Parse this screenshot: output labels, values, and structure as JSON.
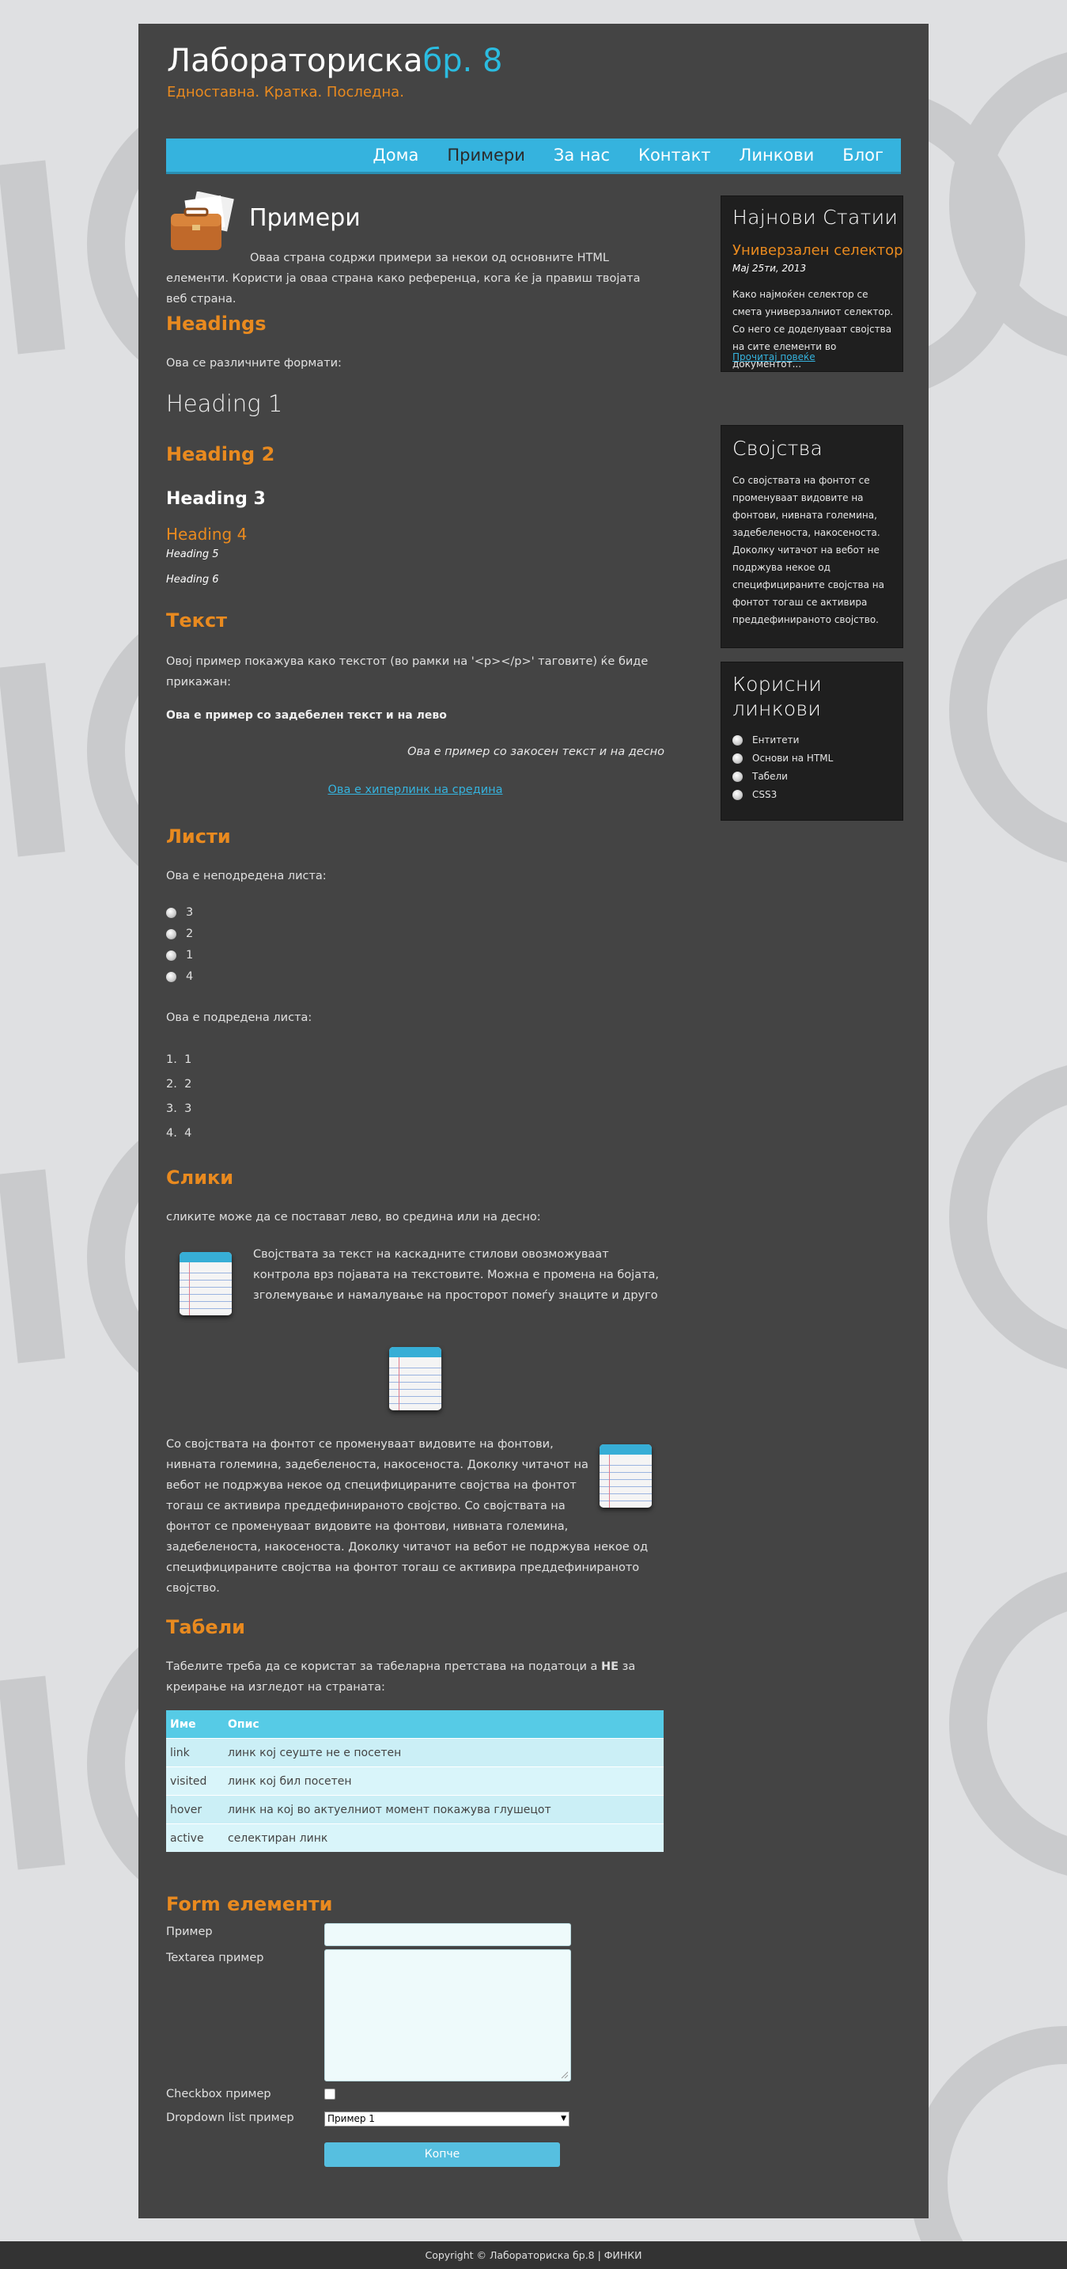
{
  "header": {
    "title_main": "Лабораториска",
    "title_accent": "бр. 8",
    "tagline": "Едноставна. Кратка. Последна."
  },
  "nav": {
    "items": [
      {
        "label": "Дома",
        "active": false
      },
      {
        "label": "Примери",
        "active": true
      },
      {
        "label": "За нас",
        "active": false
      },
      {
        "label": "Контакт",
        "active": false
      },
      {
        "label": "Линкови",
        "active": false
      },
      {
        "label": "Блог",
        "active": false
      }
    ]
  },
  "page": {
    "title": "Примери",
    "intro": "Оваа страна содржи примери за некои од основните HTML елементи. Користи ја оваа страна како референца, кога ќе ја правиш твојата веб страна."
  },
  "headings_section": {
    "title": "Headings",
    "intro": "Ова се различните формати:",
    "h1": "Heading 1",
    "h2": "Heading 2",
    "h3": "Heading 3",
    "h4": "Heading 4",
    "h5": "Heading 5",
    "h6": "Heading 6"
  },
  "text_section": {
    "title": "Текст",
    "intro": "Овој пример покажува како текстот (во рамки на '<p></p>' таговите) ќе биде прикажан:",
    "bold_left": "Ова е пример со задебелен текст и на лево",
    "italic_right": "Ова е пример со закосен текст и на десно",
    "centered_link": "Ова е хиперлинк на средина"
  },
  "lists_section": {
    "title": "Листи",
    "unordered_intro": "Ова е неподредена листа:",
    "unordered": [
      "3",
      "2",
      "1",
      "4"
    ],
    "ordered_intro": "Ова е подредена листа:",
    "ordered": [
      "1",
      "2",
      "3",
      "4"
    ]
  },
  "images_section": {
    "title": "Слики",
    "intro": "сликите може да се поставaт лево, во средина или на десно:",
    "text_left_image": "Својствата за текст на каскадните стилови овозможуваат контрола врз појавата на текстовите. Можна е промена на бојата, зголемување и намалување на просторот помеѓу знаците и друго",
    "text_right_image": "Со својствата на фонтот се променуваат видовите на фонтови, нивната големина, задебеленоста, накосеноста. Доколку читачот на вебот не подржува некое од специфицираните својства на фонтот тогаш се активира преддефинираното својство. Со својствата на фонтот се променуваат видовите на фонтови, нивната големина, задебеленоста, накосеноста. Доколку читачот на вебот не подржува некое од специфицираните својства на фонтот тогаш се активира преддефинираното својство."
  },
  "tables_section": {
    "title": "Табели",
    "intro_a": "Табелите треба да се користат за табеларна претстава на податоци а ",
    "intro_bold": "НЕ",
    "intro_b": " за креирање на изгледот на страната:",
    "headers": [
      "Име",
      "Опис"
    ],
    "rows": [
      [
        "link",
        "линк кој сеуште не е посетен"
      ],
      [
        "visited",
        "линк кој бил посетен"
      ],
      [
        "hover",
        "линк на кој во актуелниот момент покажува глушецот"
      ],
      [
        "active",
        "селектиран линк"
      ]
    ]
  },
  "form_section": {
    "title": "Form елементи",
    "label_example": "Пример",
    "label_textarea": "Textarea пример",
    "label_checkbox": "Checkbox пример",
    "label_dropdown": "Dropdown list пример",
    "dropdown_value": "Пример 1",
    "button_label": "Копче"
  },
  "sidebar": {
    "news": {
      "title": "Најнови Статии",
      "article_title": "Универзален селектор",
      "article_date": "Мај 25ти, 2013",
      "article_excerpt": "Како најмоќен селектор се смета универзалниот селектор. Со него се доделуваат својства на сите елементи во документот...",
      "read_more": "Прочитај повеќе"
    },
    "properties": {
      "title": "Својства",
      "text": "Со својствата на фонтот се променуваат видовите на фонтови, нивната големина, задебеленоста, накосеноста. Доколку читачот на вебот не подржува некое од специфицираните својства на фонтот тогаш се активира преддефинираното својство."
    },
    "links": {
      "title_line1": "Корисни",
      "title_line2": "линкови",
      "items": [
        "Ентитети",
        "Основи на HTML",
        "Табели",
        "CSS3"
      ]
    }
  },
  "footer": {
    "text": "Copyright © Лабораториска бр.8 | ФИНКИ"
  },
  "colors": {
    "accent_blue": "#35b3de",
    "accent_orange": "#e98a1f",
    "content_bg": "#444444",
    "sidebar_bg": "#1f1f1f"
  }
}
